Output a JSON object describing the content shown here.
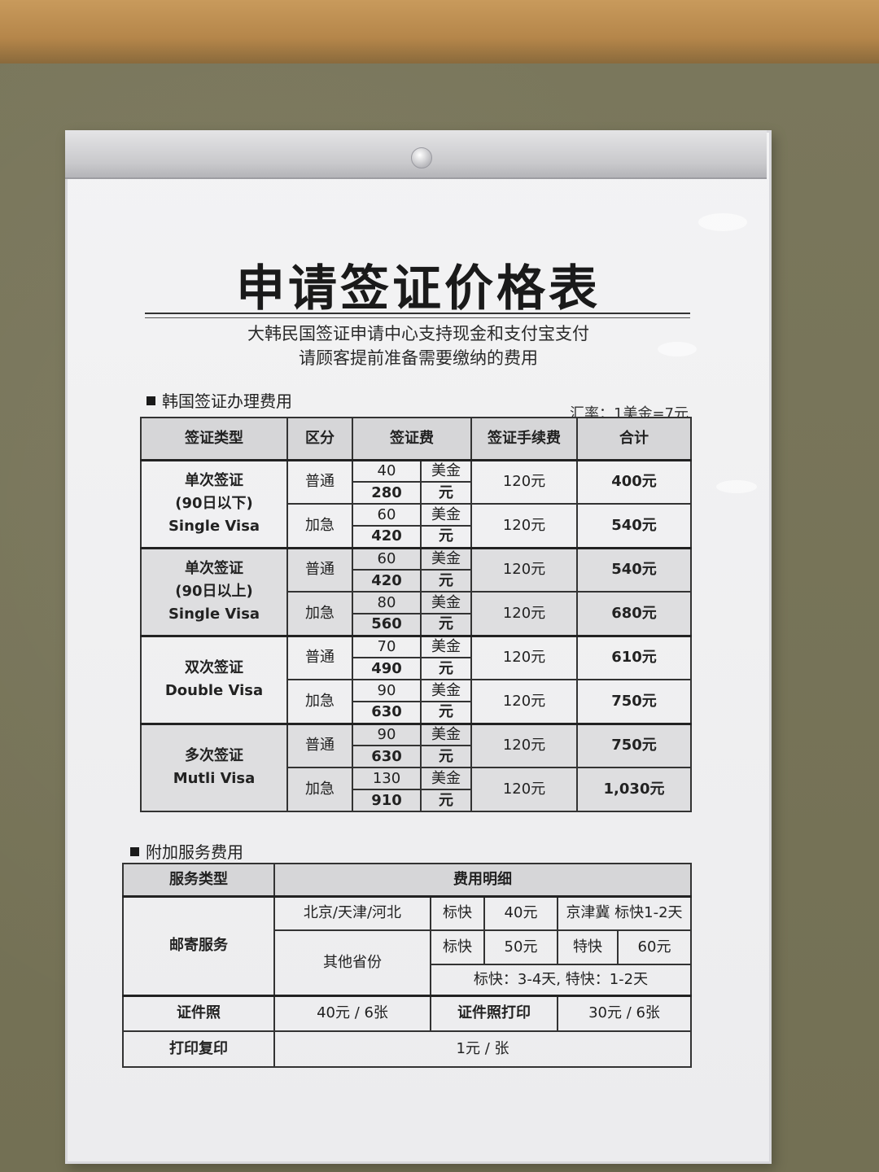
{
  "title": "申请签证价格表",
  "subtitle_lines": [
    "大韩民国签证申请中心支持现金和支付宝支付",
    "请顾客提前准备需要缴纳的费用"
  ],
  "visa_section": {
    "heading": "韩国签证办理费用",
    "exchange_rate": "汇率：1美金=7元",
    "columns": [
      "签证类型",
      "区分",
      "签证费",
      "签证手续费",
      "合计"
    ],
    "groups": [
      {
        "type_lines": [
          "单次签证",
          "(90日以下)",
          "Single Visa"
        ],
        "rows": [
          {
            "kind": "普通",
            "usd": "40",
            "usd_unit": "美金",
            "cny": "280",
            "cny_unit": "元",
            "service_fee": "120元",
            "total": "400元"
          },
          {
            "kind": "加急",
            "usd": "60",
            "usd_unit": "美金",
            "cny": "420",
            "cny_unit": "元",
            "service_fee": "120元",
            "total": "540元"
          }
        ]
      },
      {
        "type_lines": [
          "单次签证",
          "(90日以上)",
          "Single Visa"
        ],
        "rows": [
          {
            "kind": "普通",
            "usd": "60",
            "usd_unit": "美金",
            "cny": "420",
            "cny_unit": "元",
            "service_fee": "120元",
            "total": "540元"
          },
          {
            "kind": "加急",
            "usd": "80",
            "usd_unit": "美金",
            "cny": "560",
            "cny_unit": "元",
            "service_fee": "120元",
            "total": "680元"
          }
        ]
      },
      {
        "type_lines": [
          "双次签证",
          "Double Visa"
        ],
        "rows": [
          {
            "kind": "普通",
            "usd": "70",
            "usd_unit": "美金",
            "cny": "490",
            "cny_unit": "元",
            "service_fee": "120元",
            "total": "610元"
          },
          {
            "kind": "加急",
            "usd": "90",
            "usd_unit": "美金",
            "cny": "630",
            "cny_unit": "元",
            "service_fee": "120元",
            "total": "750元"
          }
        ]
      },
      {
        "type_lines": [
          "多次签证",
          "Mutli Visa"
        ],
        "rows": [
          {
            "kind": "普通",
            "usd": "90",
            "usd_unit": "美金",
            "cny": "630",
            "cny_unit": "元",
            "service_fee": "120元",
            "total": "750元"
          },
          {
            "kind": "加急",
            "usd": "130",
            "usd_unit": "美金",
            "cny": "910",
            "cny_unit": "元",
            "service_fee": "120元",
            "total": "1,030元"
          }
        ]
      }
    ]
  },
  "service_section": {
    "heading": "附加服务费用",
    "columns": [
      "服务类型",
      "费用明细"
    ],
    "mail": {
      "name": "邮寄服务",
      "region1": "北京/天津/河北",
      "r1_label": "标快",
      "r1_price": "40元",
      "r1_note": "京津冀 标快1-2天",
      "region2": "其他省份",
      "r2_label": "标快",
      "r2_price": "50元",
      "r2_fast_label": "特快",
      "r2_fast_price": "60元",
      "r2_note": "标快：3-4天, 特快：1-2天"
    },
    "photo": {
      "name": "证件照",
      "price": "40元 / 6张",
      "print_name": "证件照打印",
      "print_price": "30元 / 6张"
    },
    "copy": {
      "name": "打印复印",
      "price": "1元 / 张"
    }
  }
}
